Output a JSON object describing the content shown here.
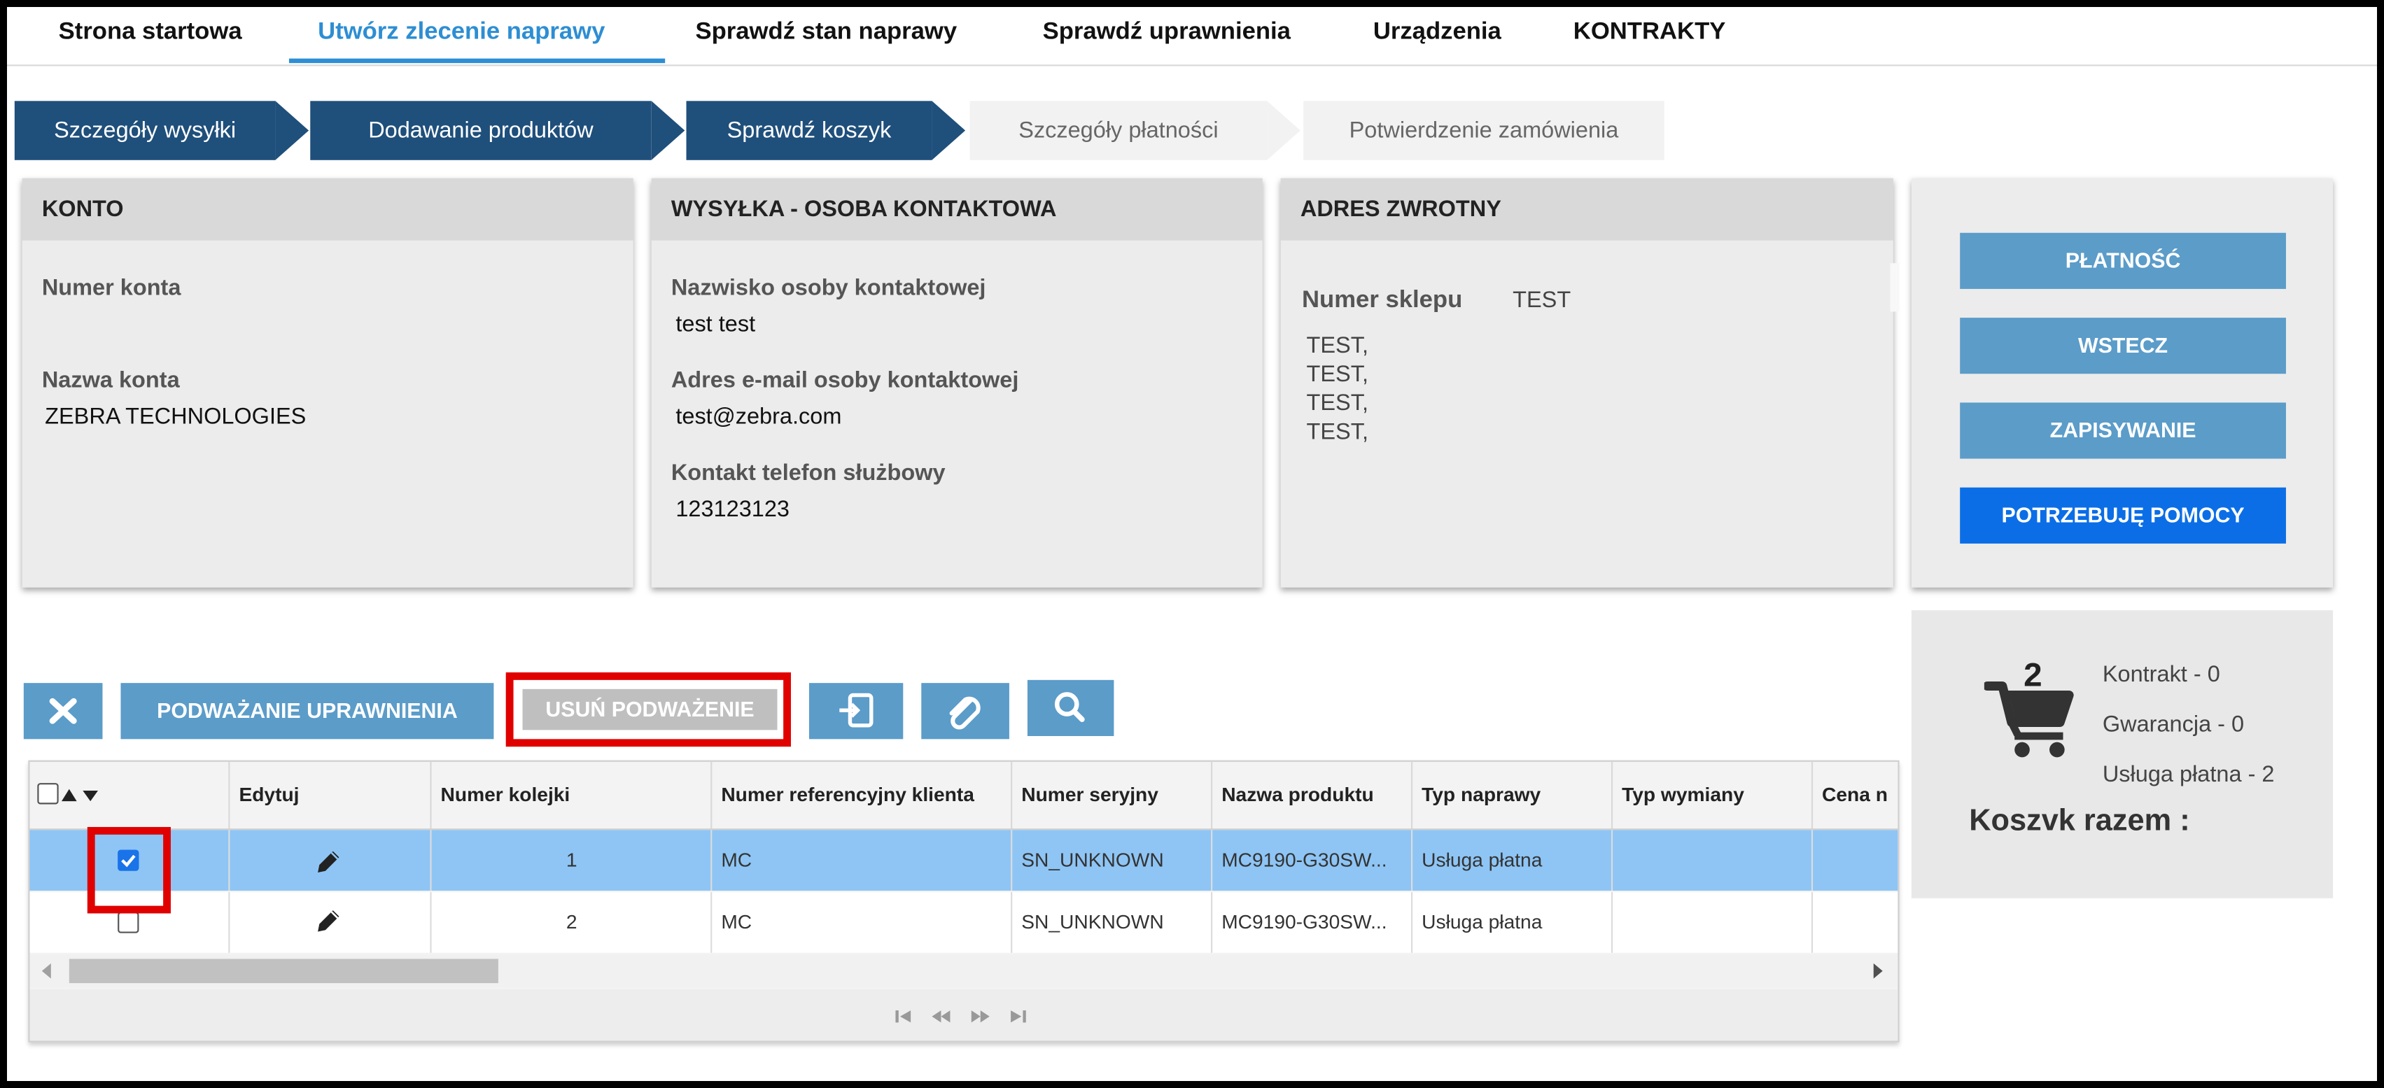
{
  "nav": {
    "items": [
      {
        "label": "Strona startowa",
        "active": false
      },
      {
        "label": "Utwórz zlecenie naprawy",
        "active": true
      },
      {
        "label": "Sprawdź stan naprawy",
        "active": false
      },
      {
        "label": "Sprawdź uprawnienia",
        "active": false
      },
      {
        "label": "Urządzenia",
        "active": false
      },
      {
        "label": "KONTRAKTY",
        "active": false
      }
    ]
  },
  "steps": [
    {
      "label": "Szczegóły wysyłki",
      "state": "done"
    },
    {
      "label": "Dodawanie produktów",
      "state": "done"
    },
    {
      "label": "Sprawdź koszyk",
      "state": "done"
    },
    {
      "label": "Szczegóły płatności",
      "state": "todo"
    },
    {
      "label": "Potwierdzenie zamówienia",
      "state": "todo"
    }
  ],
  "account": {
    "title": "KONTO",
    "number_label": "Numer konta",
    "number_value": "",
    "name_label": "Nazwa konta",
    "name_value": "ZEBRA TECHNOLOGIES"
  },
  "shipping": {
    "title": "WYSYŁKA - OSOBA KONTAKTOWA",
    "name_label": "Nazwisko osoby kontaktowej",
    "name_value": "test test",
    "email_label": "Adres e-mail osoby kontaktowej",
    "email_value": "test@zebra.com",
    "phone_label": "Kontakt telefon służbowy",
    "phone_value": "123123123"
  },
  "return_address": {
    "title": "ADRES ZWROTNY",
    "store_label": "Numer sklepu",
    "store_value": "TEST",
    "lines": [
      "TEST,",
      "TEST,",
      "TEST,",
      "TEST,"
    ]
  },
  "actions": {
    "payment": "PŁATNOŚĆ",
    "back": "WSTECZ",
    "save": "ZAPISYWANIE",
    "help": "POTRZEBUJĘ POMOCY"
  },
  "cart": {
    "count": "2",
    "contract": "Kontrakt - 0",
    "warranty": "Gwarancja - 0",
    "paid": "Usługa płatna - 2",
    "total_label": "Koszvk razem :"
  },
  "toolbar": {
    "delete_icon": "close-icon",
    "challenge": "PODWAŻANIE UPRAWNIENIA",
    "remove_challenge": "USUŃ PODWAŻENIE",
    "import_icon": "import-icon",
    "attach_icon": "paperclip-icon",
    "search_icon": "search-icon"
  },
  "grid": {
    "columns": [
      "",
      "Edytuj",
      "Numer kolejki",
      "Numer referencyjny klienta",
      "Numer seryjny",
      "Nazwa produktu",
      "Typ naprawy",
      "Typ wymiany",
      "Cena n"
    ],
    "rows": [
      {
        "checked": true,
        "queue": "1",
        "ref": "MC",
        "serial": "SN_UNKNOWN",
        "product": "MC9190-G30SW...",
        "repair": "Usługa płatna",
        "exchange": ""
      },
      {
        "checked": false,
        "queue": "2",
        "ref": "MC",
        "serial": "SN_UNKNOWN",
        "product": "MC9190-G30SW...",
        "repair": "Usługa płatna",
        "exchange": ""
      }
    ]
  },
  "colors": {
    "accent": "#2d8ed3",
    "step_done": "#1f4f7b",
    "button": "#5b9cc9",
    "help_button": "#0b6ee6",
    "selected_row": "#8ec5f5",
    "highlight": "#e00000"
  }
}
